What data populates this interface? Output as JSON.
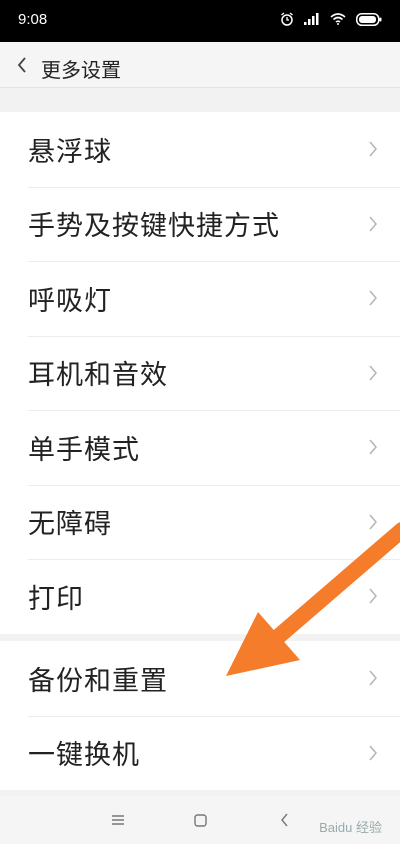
{
  "status_bar": {
    "time": "9:08",
    "icons": [
      "alarm-icon",
      "signal-icon",
      "wifi-icon",
      "battery-icon"
    ]
  },
  "header": {
    "back_icon": "chevron-left-icon",
    "title": "更多设置"
  },
  "groups": [
    {
      "items": [
        {
          "label": "悬浮球"
        },
        {
          "label": "手势及按键快捷方式"
        },
        {
          "label": "呼吸灯"
        },
        {
          "label": "耳机和音效"
        },
        {
          "label": "单手模式"
        },
        {
          "label": "无障碍"
        },
        {
          "label": "打印"
        }
      ]
    },
    {
      "items": [
        {
          "label": "备份和重置"
        },
        {
          "label": "一键换机"
        }
      ]
    }
  ],
  "annotation": {
    "type": "arrow",
    "color": "#f47c2a",
    "points_to": "备份和重置"
  },
  "nav_bar": {
    "icons": [
      "menu-icon",
      "home-icon",
      "back-icon"
    ]
  },
  "watermark": "Baidu 经验"
}
